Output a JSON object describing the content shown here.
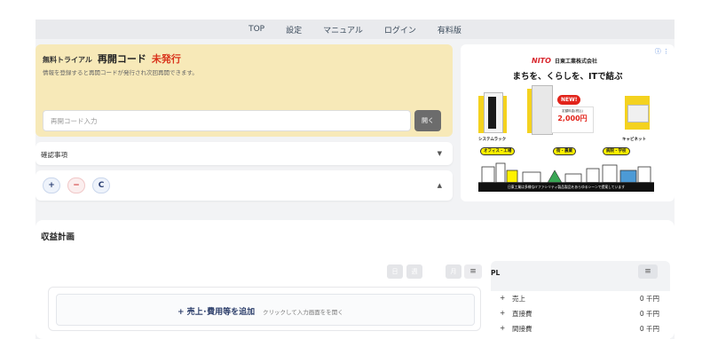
{
  "nav": {
    "items": [
      "TOP",
      "設定",
      "マニュアル",
      "ログイン",
      "有料版"
    ]
  },
  "trial": {
    "label_small": "無料トライアル",
    "label_big": "再開コード",
    "status": "未発行",
    "status_color": "#d9341c",
    "description": "情報を登録すると再開コードが発行され次回再開できます。",
    "input_placeholder": "再開コード入力",
    "input_value": "",
    "open_button": "開く"
  },
  "confirm_section": {
    "label": "確認事項",
    "caret": "▼"
  },
  "tools": {
    "plus": "+",
    "minus": "−",
    "clear": "C",
    "caret": "▲"
  },
  "ad": {
    "corner": "ⓘ ⋮",
    "logo": "NITO",
    "company": "日東工業株式会社",
    "tagline": "まちを、くらしを、ITで結ぶ",
    "new_badge": "NEW!",
    "price_caption": "定額料金(税込)",
    "price": "2,000円",
    "product_left": "システムラック",
    "product_right": "キャビネット",
    "tags": [
      "オフィス・工場",
      "街・農業",
      "病院・学校"
    ],
    "footer": "日東工業は多様なITファシリティ製品製品をあらゆるシーンで提案しています"
  },
  "plan": {
    "title": "収益計画",
    "period_buttons": [
      "日",
      "週",
      "月"
    ],
    "menu_icon": "≡",
    "add_label": "+ 売上･費用等を追加",
    "add_hint": "クリックして入力画面をを開く"
  },
  "pl": {
    "label": "PL",
    "menu_icon": "≡",
    "rows": [
      {
        "sign": "+",
        "name": "売上",
        "value": "0 千円"
      },
      {
        "sign": "+",
        "name": "直接費",
        "value": "0 千円"
      },
      {
        "sign": "+",
        "name": "間接費",
        "value": "0 千円"
      }
    ]
  }
}
